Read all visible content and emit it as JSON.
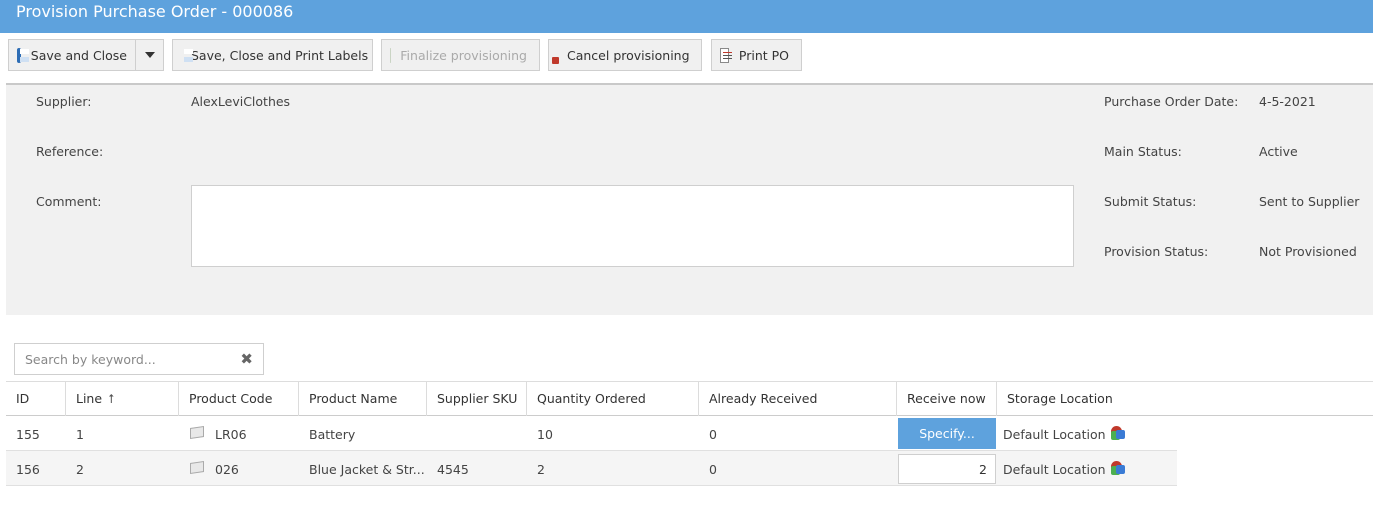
{
  "window": {
    "title": "Provision Purchase Order - 000086"
  },
  "toolbar": {
    "save_close": "Save and Close",
    "save_close_print": "Save, Close and Print Labels",
    "finalize": "Finalize provisioning",
    "cancel": "Cancel provisioning",
    "print_po": "Print PO"
  },
  "form": {
    "supplier_label": "Supplier:",
    "supplier_value": "AlexLeviClothes",
    "reference_label": "Reference:",
    "reference_value": "",
    "comment_label": "Comment:",
    "comment_value": "",
    "po_date_label": "Purchase Order Date:",
    "po_date_value": "4-5-2021",
    "main_status_label": "Main Status:",
    "main_status_value": "Active",
    "submit_status_label": "Submit Status:",
    "submit_status_value": "Sent to Supplier",
    "provision_status_label": "Provision Status:",
    "provision_status_value": "Not Provisioned"
  },
  "search": {
    "placeholder": "Search by keyword..."
  },
  "grid": {
    "columns": [
      "ID",
      "Line",
      "Product Code",
      "Product Name",
      "Supplier SKU",
      "Quantity Ordered",
      "Already Received",
      "Receive now",
      "Storage Location"
    ],
    "sort_column": "Line",
    "rows": [
      {
        "id": "155",
        "line": "1",
        "product_code": "LR06",
        "product_name": "Battery",
        "supplier_sku": "",
        "qty_ordered": "10",
        "already_received": "0",
        "receive_now": "Specify...",
        "storage_location": "Default Location"
      },
      {
        "id": "156",
        "line": "2",
        "product_code": "026",
        "product_name": "Blue Jacket & Str...",
        "supplier_sku": "4545",
        "qty_ordered": "2",
        "already_received": "0",
        "receive_now": "2",
        "storage_location": "Default Location"
      }
    ]
  },
  "colors": {
    "accent": "#5ea2dd",
    "panel": "#f1f1f1"
  },
  "icons": [
    "save-icon",
    "chevron-down-icon",
    "finalize-icon",
    "cancel-icon",
    "print-icon",
    "clear-icon",
    "sort-up-icon",
    "product-box-icon",
    "location-icon"
  ]
}
